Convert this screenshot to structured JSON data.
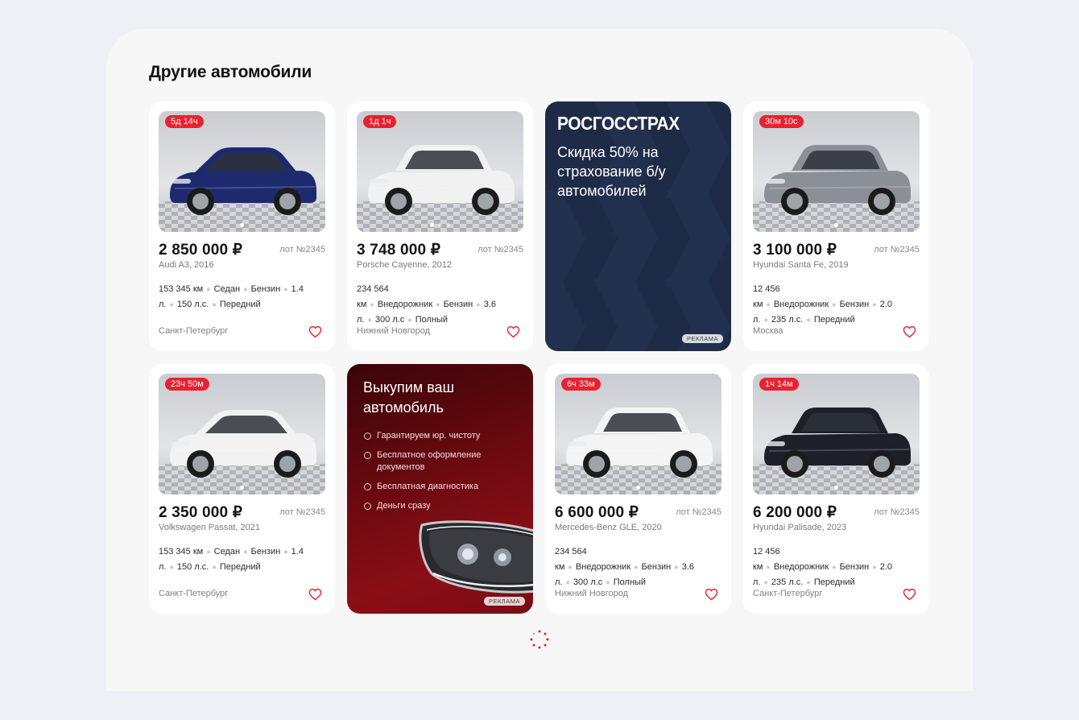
{
  "section": {
    "title": "Другие автомобили"
  },
  "cars": [
    {
      "timer": "5д 14ч",
      "price": "2 850 000 ₽",
      "lot": "лот №2345",
      "model": "Audi A3, 2016",
      "specs": [
        "153 345 км",
        "Седан",
        "Бензин",
        "1.4 л.",
        "150 л.с.",
        "Передний"
      ],
      "city": "Санкт-Петербург",
      "photo_dots": 1,
      "active_dot": 0,
      "color": "#1e2a6e"
    },
    {
      "timer": "1д 1ч",
      "price": "3 748 000 ₽",
      "lot": "лот №2345",
      "model": "Porsche Cayenne, 2012",
      "specs": [
        "234 564 км",
        "Внедорожник",
        "Бензин",
        "3.6 л.",
        "300 л.с",
        "Полный"
      ],
      "city": "Нижний Новгород",
      "photo_dots": 3,
      "active_dot": 0,
      "color": "#f1f1f1"
    },
    {
      "timer": "30м 10с",
      "price": "3 100 000 ₽",
      "lot": "лот №2345",
      "model": "Hyundai Santa Fe, 2019",
      "specs": [
        "12 456 км",
        "Внедорожник",
        "Бензин",
        "2.0 л.",
        "235 л.с.",
        "Передний"
      ],
      "city": "Москва",
      "photo_dots": 1,
      "active_dot": 0,
      "color": "#8b8f96"
    },
    {
      "timer": "23ч 50м",
      "price": "2 350 000 ₽",
      "lot": "лот №2345",
      "model": "Volkswagen Passat, 2021",
      "specs": [
        "153 345 км",
        "Седан",
        "Бензин",
        "1.4 л.",
        "150 л.с.",
        "Передний"
      ],
      "city": "Санкт-Петербург",
      "photo_dots": 1,
      "active_dot": 0,
      "color": "#f2f2f2"
    },
    {
      "timer": "6ч 33м",
      "price": "6 600 000 ₽",
      "lot": "лот №2345",
      "model": "Mercedes-Benz GLE, 2020",
      "specs": [
        "234 564 км",
        "Внедорожник",
        "Бензин",
        "3.6 л.",
        "300 л.с",
        "Полный"
      ],
      "city": "Нижний Новгород",
      "photo_dots": 1,
      "active_dot": 0,
      "color": "#f4f4f4"
    },
    {
      "timer": "1ч 14м",
      "price": "6 200 000 ₽",
      "lot": "лот №2345",
      "model": "Hyundai Palisade, 2023",
      "specs": [
        "12 456 км",
        "Внедорожник",
        "Бензин",
        "2.0 л.",
        "235 л.с.",
        "Передний"
      ],
      "city": "Санкт-Петербург",
      "photo_dots": 1,
      "active_dot": 0,
      "color": "#1d2029"
    }
  ],
  "ad_insurance": {
    "brand": "РОСГОССТРАХ",
    "headline": "Скидка 50% на страхование б/у автомобилей",
    "label": "РЕКЛАМА"
  },
  "ad_buyout": {
    "headline": "Выкупим ваш автомобиль",
    "items": [
      "Гарантируем юр. чистоту",
      "Бесплатное оформление документов",
      "Бесплатная диагностика",
      "Деньги сразу"
    ],
    "label": "РЕКЛАМА"
  },
  "colors": {
    "accent": "#e8222f",
    "ad_blue": "#1e2b47",
    "ad_red": "#7a0c14"
  }
}
